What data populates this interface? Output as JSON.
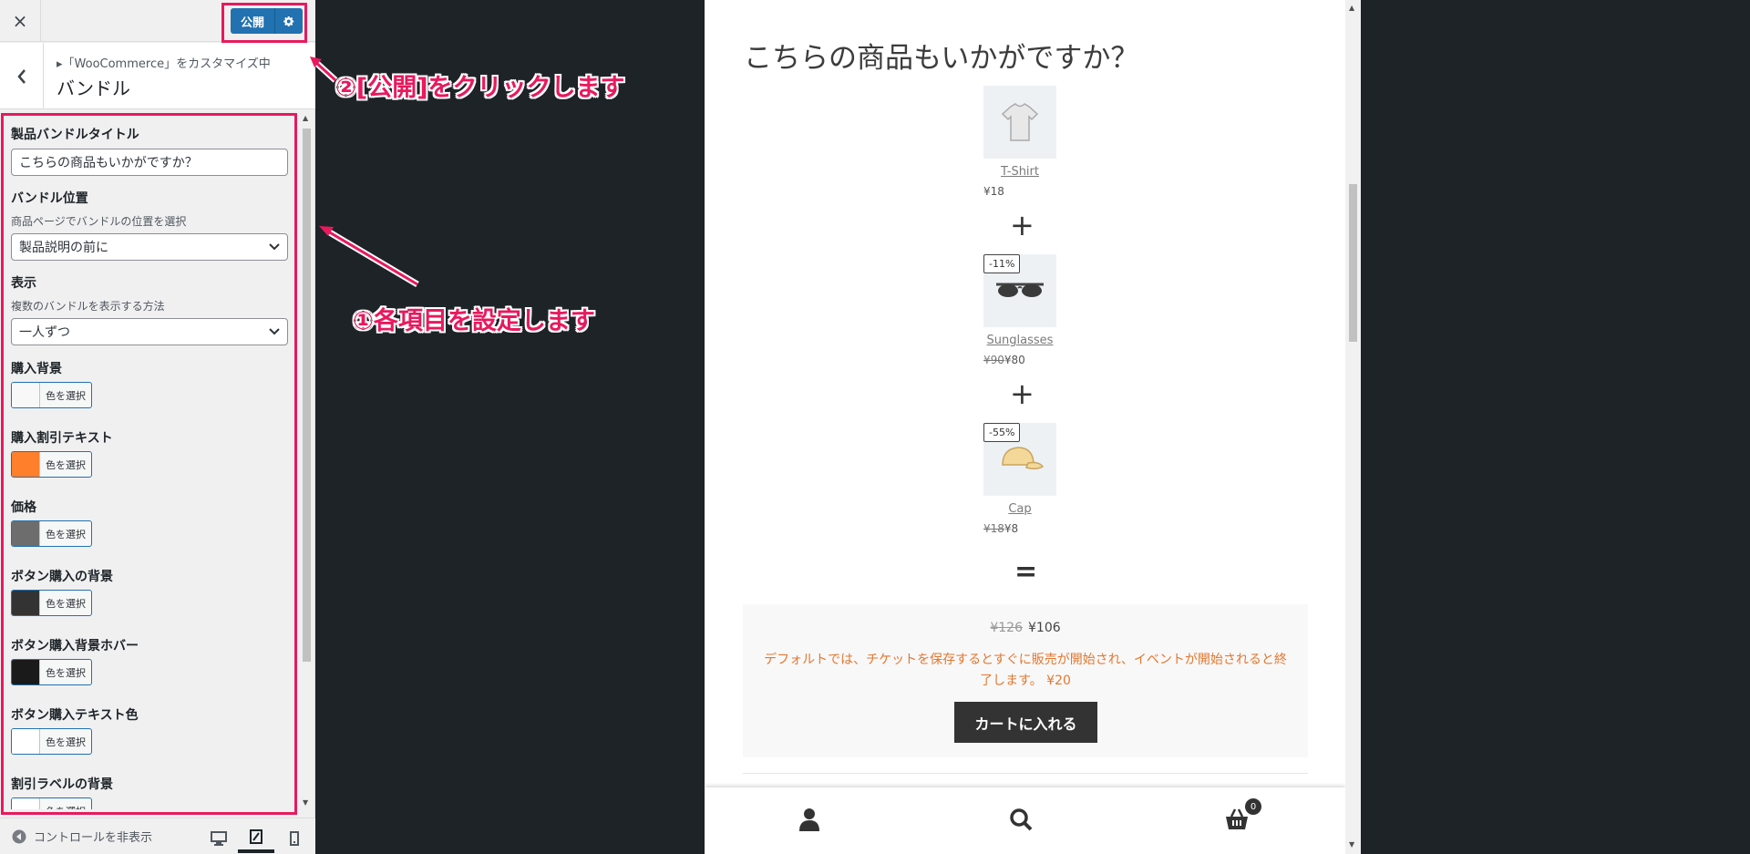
{
  "topbar": {
    "close_icon": "×",
    "publish_label": "公開"
  },
  "section": {
    "breadcrumb": "▸「WooCommerce」をカスタマイズ中",
    "title": "バンドル"
  },
  "controls": {
    "bundle_title_label": "製品バンドルタイトル",
    "bundle_title_value": "こちらの商品もいかがですか？",
    "position_label": "バンドル位置",
    "position_desc": "商品ページでバンドルの位置を選択",
    "position_value": "製品説明の前に",
    "display_label": "表示",
    "display_desc": "複数のバンドルを表示する方法",
    "display_value": "一人ずつ",
    "color_button_label": "色を選択",
    "colors": [
      {
        "label": "購入背景",
        "swatch": "#f8f8f8"
      },
      {
        "label": "購入割引テキスト",
        "swatch": "#ff7f2a"
      },
      {
        "label": "価格",
        "swatch": "#6d6d6d"
      },
      {
        "label": "ボタン購入の背景",
        "swatch": "#333333"
      },
      {
        "label": "ボタン購入背景ホバー",
        "swatch": "#1a1a1a"
      },
      {
        "label": "ボタン購入テキスト色",
        "swatch": "#ffffff"
      },
      {
        "label": "割引ラベルの背景",
        "swatch": "#ffffff"
      }
    ]
  },
  "footer": {
    "collapse_label": "コントロールを非表示"
  },
  "annotations": {
    "step1": "①各項目を設定します",
    "step2": "②[公開]をクリックします"
  },
  "preview": {
    "bundle_title": "こちらの商品もいかがですか？",
    "products": [
      {
        "name": "T-Shirt",
        "price": "¥18",
        "old_price": "",
        "badge": ""
      },
      {
        "name": "Sunglasses",
        "price": "¥80",
        "old_price": "¥90",
        "badge": "-11%"
      },
      {
        "name": "Cap",
        "price": "¥8",
        "old_price": "¥18",
        "badge": "-55%"
      }
    ],
    "plus": "+",
    "equal": "=",
    "total_old": "¥126",
    "total_new": "¥106",
    "discount_note": "デフォルトでは、チケットを保存するとすぐに販売が開始され、イベントが開始されると終了します。",
    "discount_amount": "¥20",
    "add_to_cart": "カートに入れる",
    "cart_count": "0"
  },
  "theme": {
    "accent": "#2271b1",
    "annotation": "#e8195d",
    "discount_text": "#e27730"
  }
}
